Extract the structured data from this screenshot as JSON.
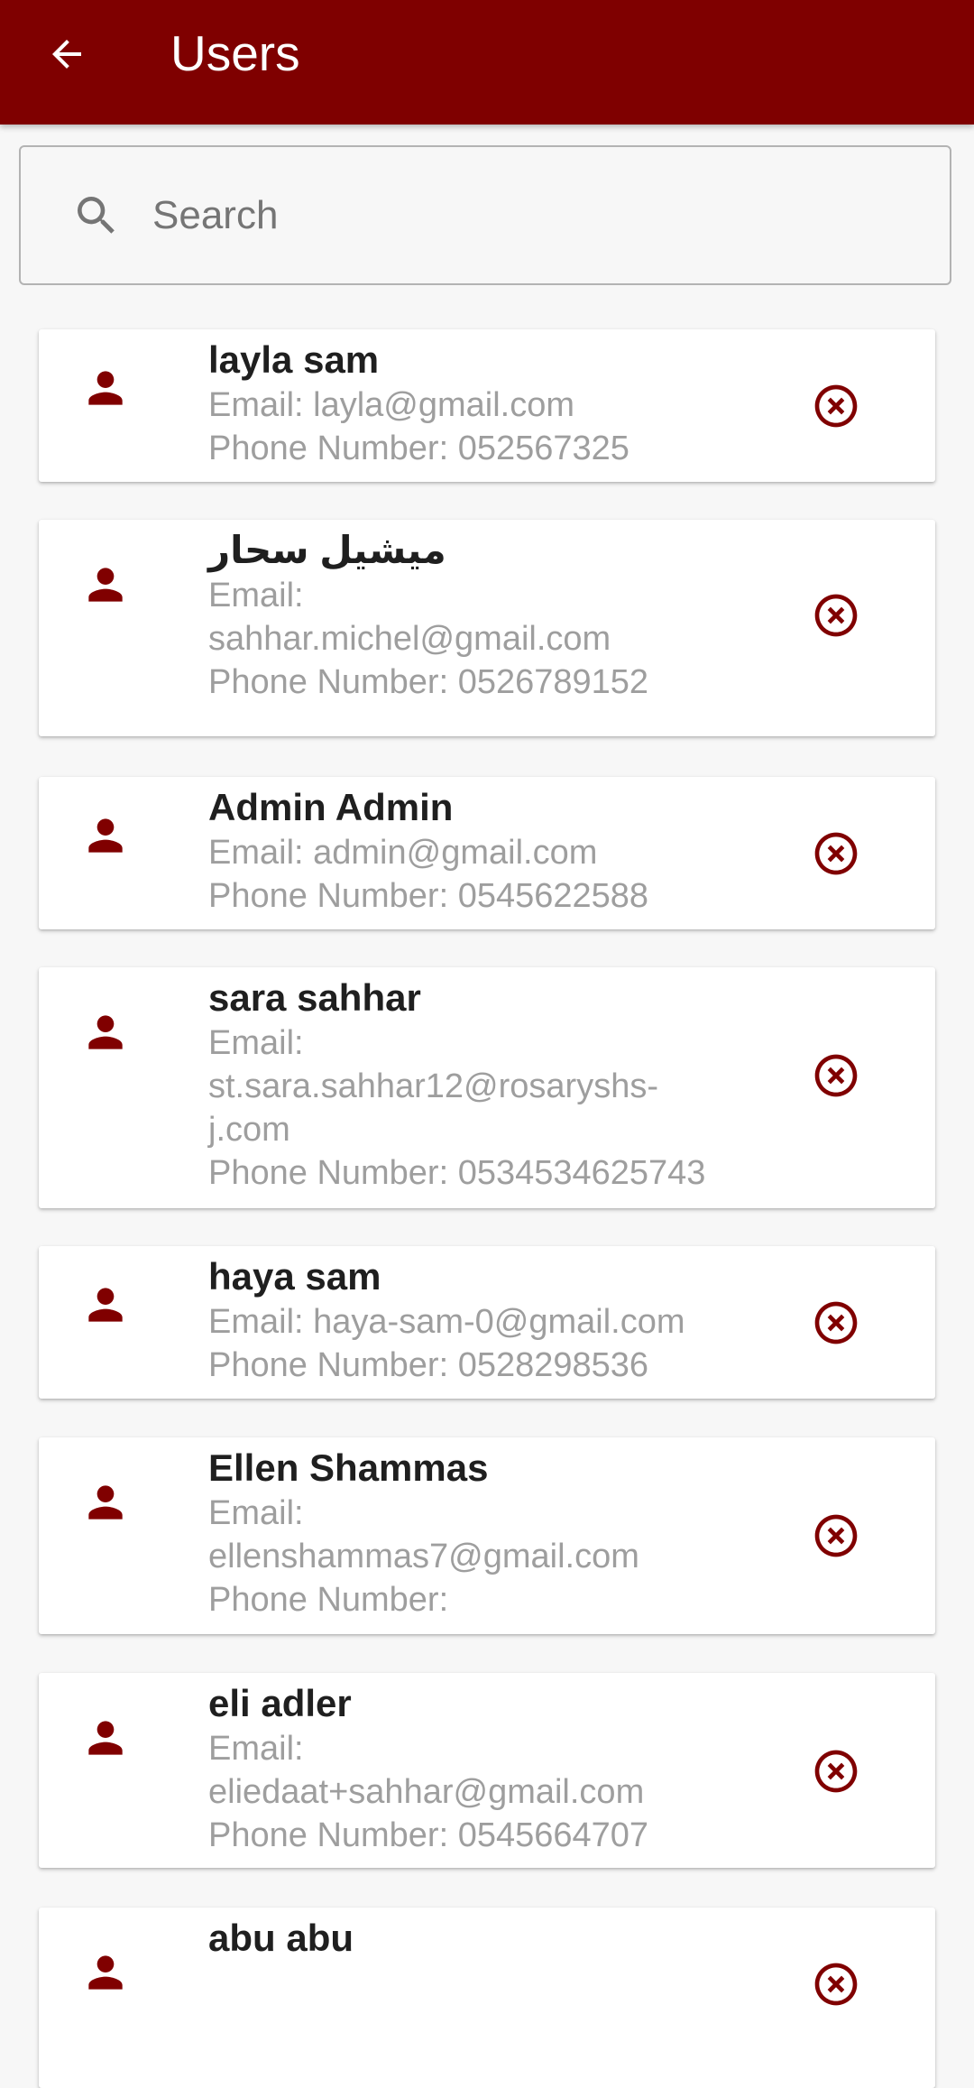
{
  "appbar": {
    "title": "Users",
    "back_icon": "arrow-left-icon"
  },
  "search": {
    "placeholder": "Search",
    "value": "",
    "icon": "search-icon"
  },
  "colors": {
    "primary": "#7f0000",
    "icon": "#800000",
    "name_text": "#1f1f1f",
    "detail_text": "#9e9e9e",
    "background": "#f7f7f7"
  },
  "users": [
    {
      "name": "layla sam",
      "email_lines": [
        "Email: layla@gmail.com"
      ],
      "phone": "Phone Number: 052567325"
    },
    {
      "name": "ميشيل سحار",
      "email_lines": [
        "Email:",
        "sahhar.michel@gmail.com"
      ],
      "phone": "Phone Number: 0526789152"
    },
    {
      "name": "Admin Admin",
      "email_lines": [
        "Email: admin@gmail.com"
      ],
      "phone": "Phone Number: 0545622588"
    },
    {
      "name": "sara sahhar",
      "email_lines": [
        "Email:",
        "st.sara.sahhar12@rosaryshs-",
        "j.com"
      ],
      "phone": "Phone Number: 0534534625743"
    },
    {
      "name": "haya sam",
      "email_lines": [
        "Email: haya-sam-0@gmail.com"
      ],
      "phone": "Phone Number: 0528298536"
    },
    {
      "name": "Ellen Shammas",
      "email_lines": [
        "Email:",
        "ellenshammas7@gmail.com"
      ],
      "phone": "Phone Number:"
    },
    {
      "name": "eli adler",
      "email_lines": [
        "Email:",
        "eliedaat+sahhar@gmail.com"
      ],
      "phone": "Phone Number: 0545664707"
    },
    {
      "name": "abu abu",
      "email_lines": [],
      "phone": ""
    }
  ]
}
